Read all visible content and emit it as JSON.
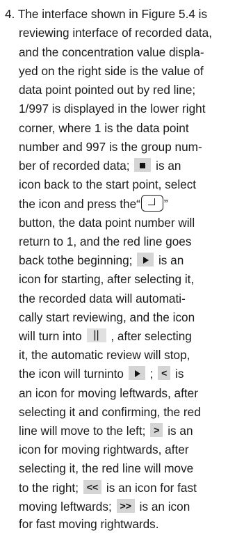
{
  "item_number": "4.",
  "lines": [
    "The interface shown in Figure 5.4 is",
    "reviewing interface of recorded data,",
    "and the concentration value displa-",
    "yed on the right side is the value of",
    "data point pointed out by red line;",
    "1/997 is displayed in the lower right",
    "corner, where 1 is the data point",
    "number and 997 is the group num-",
    "ber of recorded data;",
    "is  an",
    "icon back to the start point, select",
    "the icon and press the“",
    "”",
    "button, the data point number will",
    "return to 1, and the red line goes",
    "back tothe beginning;",
    "is an",
    "icon for starting, after selecting it,",
    "the recorded data will automati-",
    "cally start reviewing, and the icon",
    "will turn into",
    ", after selecting",
    "it, the automatic review will stop,",
    "the icon will turninto",
    ";",
    "is",
    "an icon for moving leftwards, after",
    "selecting it and confirming, the red",
    "line will move to the left;",
    "is an",
    "icon for moving rightwards, after",
    "selecting it, the red line will move",
    "to the right;",
    "is an icon for  fast",
    "moving leftwards;",
    "is an icon",
    "for fast moving rightwards."
  ],
  "icons": {
    "pause": "||",
    "left": "<",
    "right": ">",
    "fast_left": "<<",
    "fast_right": ">>"
  }
}
